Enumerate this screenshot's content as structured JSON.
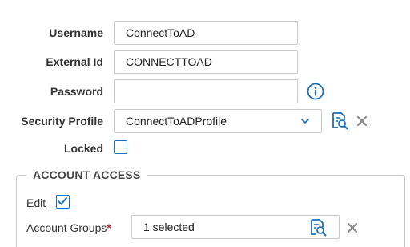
{
  "fields": {
    "username": {
      "label": "Username",
      "value": "ConnectToAD"
    },
    "external_id": {
      "label": "External Id",
      "value": "CONNECTTOAD"
    },
    "password": {
      "label": "Password",
      "value": "",
      "info_icon": "info-icon"
    },
    "security_profile": {
      "label": "Security Profile",
      "value": "ConnectToADProfile",
      "lookup_icon": "lookup-icon",
      "clear_icon": "close-icon"
    },
    "locked": {
      "label": "Locked",
      "checked": false
    }
  },
  "account_access": {
    "title": "ACCOUNT ACCESS",
    "edit": {
      "label": "Edit",
      "checked": true
    },
    "account_groups": {
      "label": "Account Groups",
      "required_mark": "*",
      "value": "1 selected",
      "lookup_icon": "lookup-icon",
      "clear_icon": "close-icon"
    }
  },
  "colors": {
    "accent": "#1f6fb8",
    "required": "#c0282b",
    "clear": "#8a8a8a",
    "border": "#c8c8c8"
  }
}
